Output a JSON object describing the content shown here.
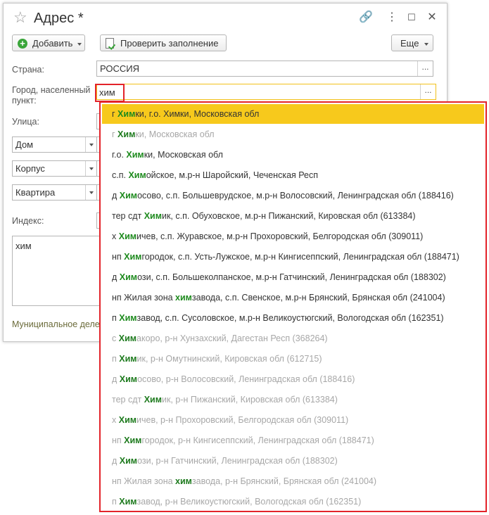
{
  "window": {
    "title": "Адрес *"
  },
  "toolbar": {
    "add_label": "Добавить",
    "check_label": "Проверить заполнение",
    "more_label": "Еще"
  },
  "form": {
    "country_label": "Страна:",
    "country_value": "РОССИЯ",
    "city_label_1": "Город, населенный",
    "city_label_2": "пункт:",
    "city_value": "хим",
    "street_label": "Улица:",
    "house_type": "Дом",
    "building_type": "Корпус",
    "apartment_type": "Квартира",
    "index_label": "Индекс:",
    "memo_value": "хим",
    "municipal_label": "Муниципальное деле"
  },
  "suggestions": [
    {
      "pre": "г ",
      "match": "Хим",
      "post": "ки, г.о. Химки, Московская обл",
      "dim": false,
      "selected": true
    },
    {
      "pre": "г ",
      "match": "Хим",
      "post": "ки, Московская обл",
      "dim": true,
      "selected": false
    },
    {
      "pre": "г.о. ",
      "match": "Хим",
      "post": "ки, Московская обл",
      "dim": false,
      "selected": false
    },
    {
      "pre": "с.п. ",
      "match": "Хим",
      "post": "ойское, м.р-н Шаройский, Чеченская Респ",
      "dim": false,
      "selected": false
    },
    {
      "pre": "д ",
      "match": "Хим",
      "post": "осово, с.п. Большеврудское, м.р-н Волосовский, Ленинградская обл (188416)",
      "dim": false,
      "selected": false
    },
    {
      "pre": "тер сдт ",
      "match": "Хим",
      "post": "ик, с.п. Обуховское, м.р-н Пижанский, Кировская обл (613384)",
      "dim": false,
      "selected": false
    },
    {
      "pre": "х ",
      "match": "Хим",
      "post": "ичев, с.п. Журавское, м.р-н Прохоровский, Белгородская обл (309011)",
      "dim": false,
      "selected": false
    },
    {
      "pre": "нп ",
      "match": "Хим",
      "post": "городок, с.п. Усть-Лужское, м.р-н Кингисеппский, Ленинградская обл (188471)",
      "dim": false,
      "selected": false
    },
    {
      "pre": "д ",
      "match": "Хим",
      "post": "ози, с.п. Большеколпанское, м.р-н Гатчинский, Ленинградская обл (188302)",
      "dim": false,
      "selected": false
    },
    {
      "pre": "нп Жилая зона ",
      "match": "хим",
      "post": "завода, с.п. Свенское, м.р-н Брянский, Брянская обл (241004)",
      "dim": false,
      "selected": false
    },
    {
      "pre": "п ",
      "match": "Хим",
      "post": "завод, с.п. Сусоловское, м.р-н Великоустюгский, Вологодская обл (162351)",
      "dim": false,
      "selected": false
    },
    {
      "pre": "с ",
      "match": "Хим",
      "post": "акоро, р-н Хунзахский, Дагестан Респ (368264)",
      "dim": true,
      "selected": false
    },
    {
      "pre": "п ",
      "match": "Хим",
      "post": "ик, р-н Омутнинский, Кировская обл (612715)",
      "dim": true,
      "selected": false
    },
    {
      "pre": "д ",
      "match": "Хим",
      "post": "осово, р-н Волосовский, Ленинградская обл (188416)",
      "dim": true,
      "selected": false
    },
    {
      "pre": "тер сдт ",
      "match": "Хим",
      "post": "ик, р-н Пижанский, Кировская обл (613384)",
      "dim": true,
      "selected": false
    },
    {
      "pre": "х ",
      "match": "Хим",
      "post": "ичев, р-н Прохоровский, Белгородская обл (309011)",
      "dim": true,
      "selected": false
    },
    {
      "pre": "нп ",
      "match": "Хим",
      "post": "городок, р-н Кингисеппский, Ленинградская обл (188471)",
      "dim": true,
      "selected": false
    },
    {
      "pre": "д ",
      "match": "Хим",
      "post": "ози, р-н Гатчинский, Ленинградская обл (188302)",
      "dim": true,
      "selected": false
    },
    {
      "pre": "нп Жилая зона ",
      "match": "хим",
      "post": "завода, р-н Брянский, Брянская обл (241004)",
      "dim": true,
      "selected": false
    },
    {
      "pre": "п ",
      "match": "Хим",
      "post": "завод, р-н Великоустюгский, Вологодская обл (162351)",
      "dim": true,
      "selected": false
    }
  ],
  "colors": {
    "highlight": "#f7c91c",
    "match_text": "#1d8a1d",
    "focus_border": "#e3232a"
  }
}
